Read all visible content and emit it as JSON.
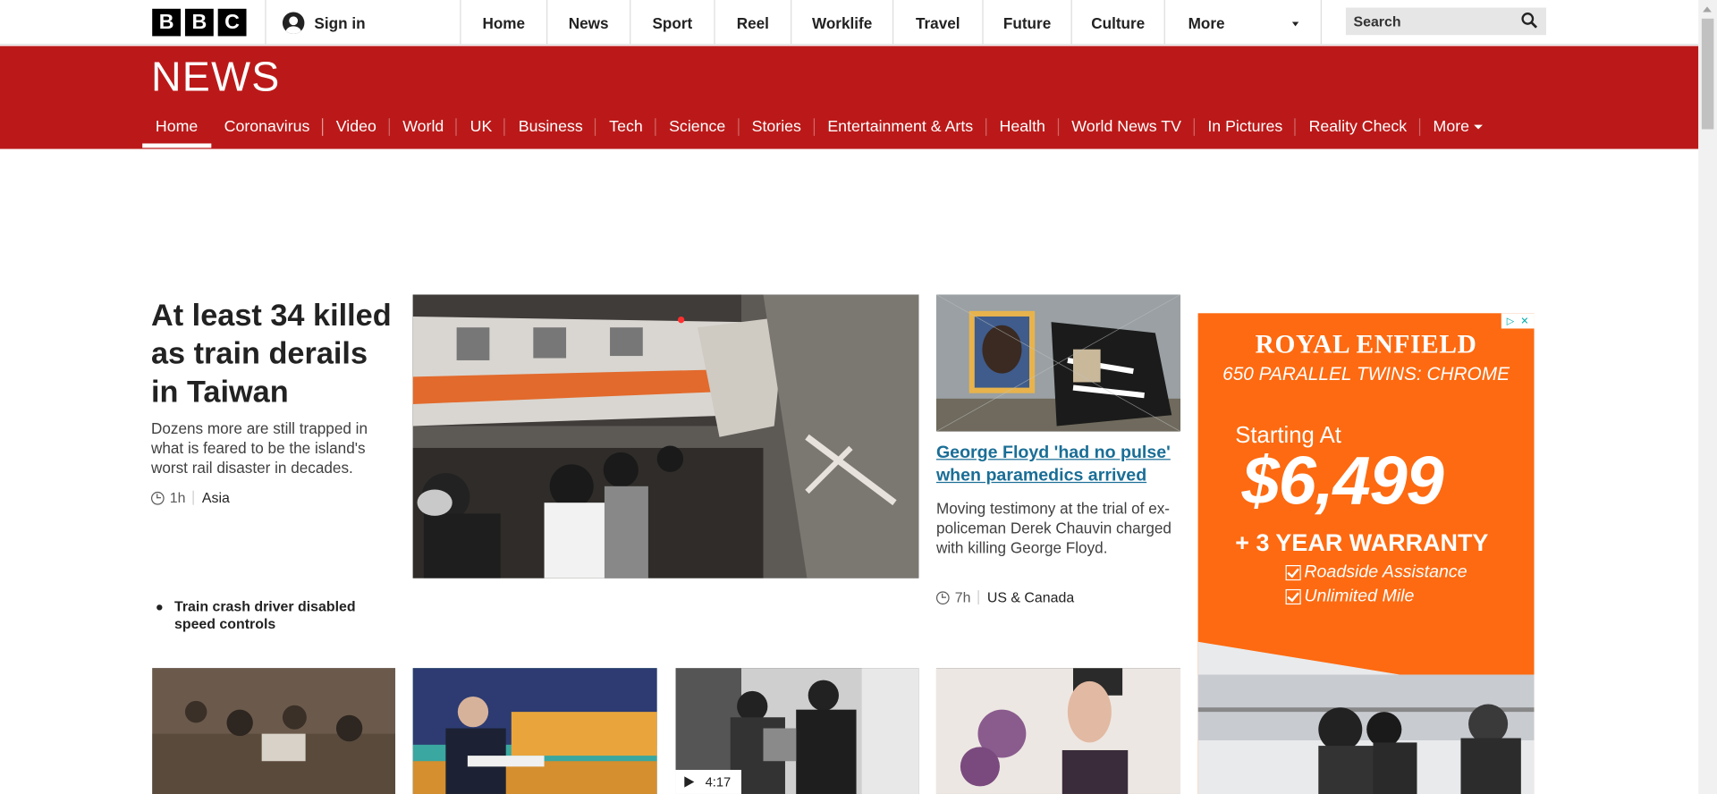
{
  "topbar": {
    "logo_letters": [
      "B",
      "B",
      "C"
    ],
    "sign_in": "Sign in",
    "nav": [
      {
        "label": "Home"
      },
      {
        "label": "News"
      },
      {
        "label": "Sport"
      },
      {
        "label": "Reel"
      },
      {
        "label": "Worklife"
      },
      {
        "label": "Travel"
      },
      {
        "label": "Future"
      },
      {
        "label": "Culture"
      }
    ],
    "more": "More",
    "search_label": "Search"
  },
  "news": {
    "title": "NEWS",
    "brand_color": "#bb1919",
    "nav": [
      {
        "label": "Home",
        "active": true
      },
      {
        "label": "Coronavirus"
      },
      {
        "label": "Video"
      },
      {
        "label": "World"
      },
      {
        "label": "UK"
      },
      {
        "label": "Business"
      },
      {
        "label": "Tech"
      },
      {
        "label": "Science"
      },
      {
        "label": "Stories"
      },
      {
        "label": "Entertainment & Arts"
      },
      {
        "label": "Health"
      },
      {
        "label": "World News TV"
      },
      {
        "label": "In Pictures"
      },
      {
        "label": "Reality Check"
      }
    ],
    "more": "More"
  },
  "lead": {
    "headline": "At least 34 killed as train derails in Taiwan",
    "summary": "Dozens more are still trapped in what is feared to be the island's worst rail disaster in decades.",
    "time": "1h",
    "section": "Asia",
    "related": "Train crash driver disabled speed controls"
  },
  "second": {
    "headline": "George Floyd 'had no pulse' when paramedics arrived",
    "summary": "Moving testimony at the trial of ex-policeman Derek Chauvin charged with killing George Floyd.",
    "time": "7h",
    "section": "US & Canada",
    "link_color": "#1a6e96"
  },
  "video_duration": "4:17",
  "ad": {
    "brand": "ROYAL ENFIELD",
    "line2": "650 PARALLEL TWINS: CHROME",
    "starting": "Starting At",
    "price": "$6,499",
    "warranty": "+ 3 YEAR WARRANTY",
    "perks": [
      "Roadside Assistance",
      "Unlimited Mile"
    ],
    "color": "#fd6a11"
  }
}
